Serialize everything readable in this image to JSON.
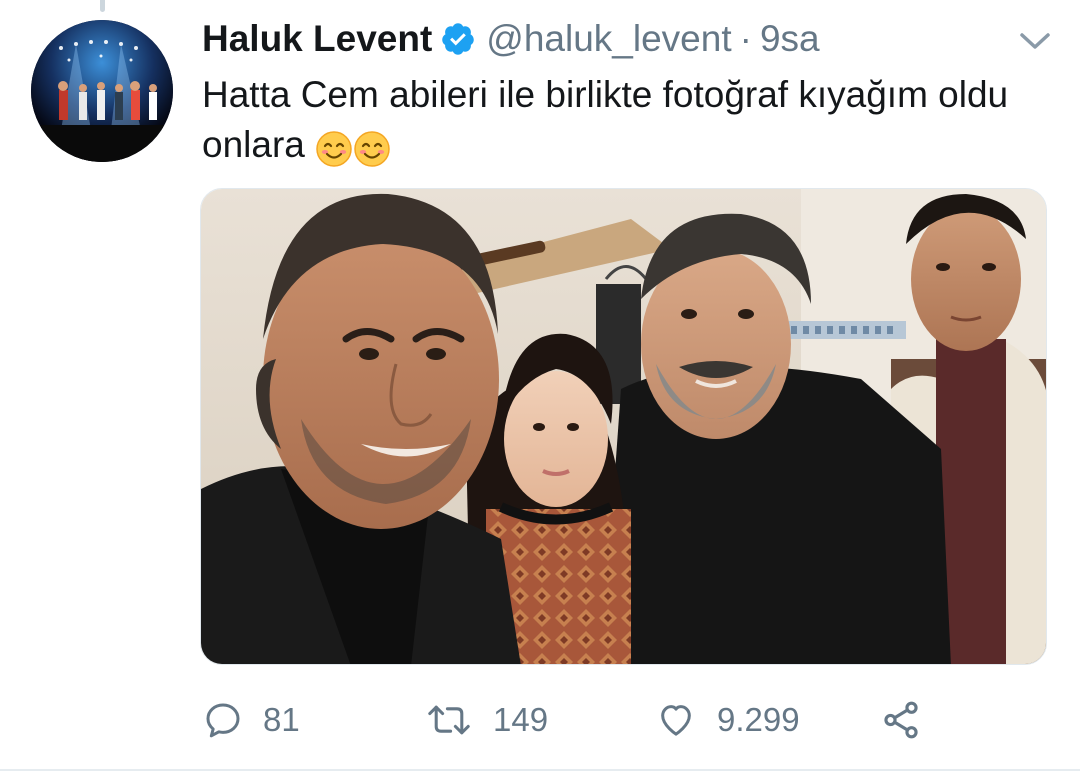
{
  "tweet": {
    "author_name": "Haluk Levent",
    "handle": "@haluk_levent",
    "separator": "·",
    "time": "9sa",
    "text": "Hatta Cem abileri ile birlikte fotoğraf kıyağım oldu onlara",
    "emojis": [
      "smiling-face-emoji",
      "smiling-face-emoji"
    ]
  },
  "actions": {
    "reply_count": "81",
    "retweet_count": "149",
    "like_count": "9.299"
  },
  "colors": {
    "verified_blue": "#1da1f2",
    "secondary_text": "#657786",
    "primary_text": "#14171a",
    "divider": "#e6ecf0"
  },
  "icons": {
    "verified": "verified-badge-icon",
    "menu": "chevron-down-icon",
    "reply": "reply-icon",
    "retweet": "retweet-icon",
    "like": "heart-icon",
    "share": "share-icon"
  }
}
